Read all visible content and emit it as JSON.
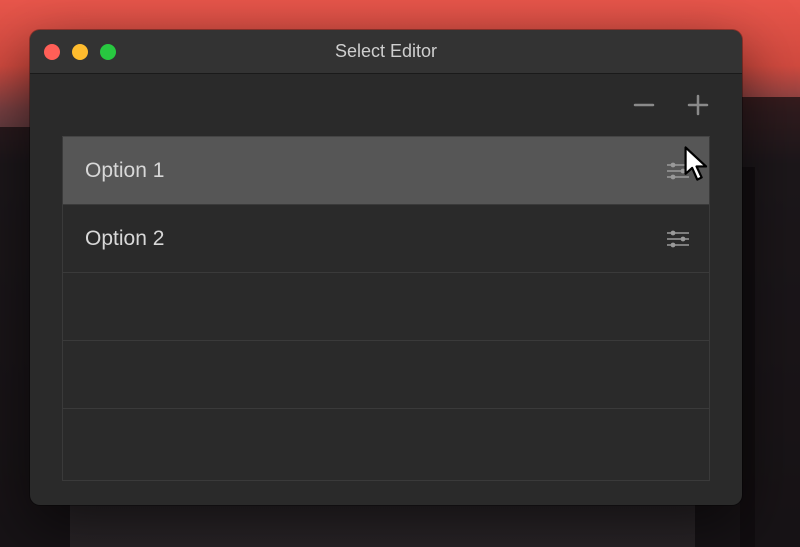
{
  "window": {
    "title": "Select Editor"
  },
  "toolbar": {
    "remove_icon": "minus",
    "add_icon": "plus"
  },
  "list": {
    "items": [
      {
        "label": "Option 1",
        "selected": true,
        "has_settings": true
      },
      {
        "label": "Option 2",
        "selected": false,
        "has_settings": true
      },
      {
        "label": "",
        "selected": false,
        "has_settings": false
      },
      {
        "label": "",
        "selected": false,
        "has_settings": false
      },
      {
        "label": "",
        "selected": false,
        "has_settings": false
      }
    ]
  }
}
